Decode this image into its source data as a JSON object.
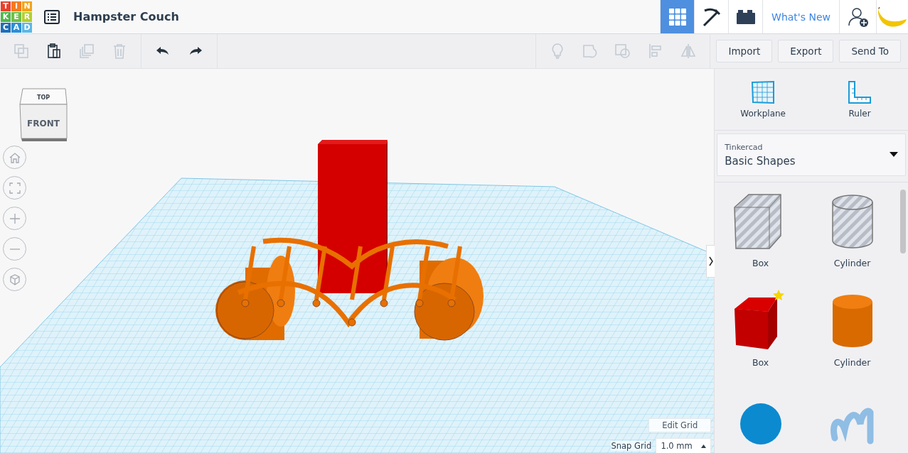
{
  "logo": {
    "letters": [
      {
        "char": "T",
        "color": "#e8412c"
      },
      {
        "char": "I",
        "color": "#f47b20"
      },
      {
        "char": "N",
        "color": "#f2a31b"
      },
      {
        "char": "K",
        "color": "#4fb848"
      },
      {
        "char": "E",
        "color": "#70bf44"
      },
      {
        "char": "R",
        "color": "#b5cf2c"
      },
      {
        "char": "C",
        "color": "#1f6fb8"
      },
      {
        "char": "A",
        "color": "#2b8fd6"
      },
      {
        "char": "D",
        "color": "#5cb8e6"
      }
    ]
  },
  "design_title": "Hampster Couch",
  "nav": [
    {
      "kind": "grid",
      "selected": true
    },
    {
      "kind": "pickaxe",
      "selected": false
    },
    {
      "kind": "bricks",
      "selected": false
    }
  ],
  "whats_new": "What's New",
  "edit_tools": [
    {
      "kind": "copy",
      "disabled": true
    },
    {
      "kind": "paste",
      "disabled": false
    },
    {
      "kind": "duplicate",
      "disabled": true
    },
    {
      "kind": "delete",
      "disabled": true
    }
  ],
  "history_tools": [
    {
      "kind": "undo",
      "disabled": false
    },
    {
      "kind": "redo",
      "disabled": false
    }
  ],
  "shape_tools": [
    {
      "kind": "bulb",
      "disabled": true
    },
    {
      "kind": "note",
      "disabled": true
    },
    {
      "kind": "group",
      "disabled": true
    },
    {
      "kind": "align",
      "disabled": true
    },
    {
      "kind": "mirror",
      "disabled": true
    }
  ],
  "actions": [
    "Import",
    "Export",
    "Send To"
  ],
  "view_cube": {
    "top": "TOP",
    "front": "FRONT"
  },
  "view_controls": [
    {
      "kind": "home"
    },
    {
      "kind": "fit"
    },
    {
      "kind": "zoom-in"
    },
    {
      "kind": "zoom-out"
    },
    {
      "kind": "perspective"
    }
  ],
  "grid": {
    "edit": "Edit Grid",
    "snap_label": "Snap Grid",
    "snap_value": "1.0 mm"
  },
  "panel_tools": [
    {
      "kind": "workplane",
      "label": "Workplane"
    },
    {
      "kind": "ruler",
      "label": "Ruler"
    }
  ],
  "library": {
    "label": "Tinkercad",
    "value": "Basic Shapes"
  },
  "shapes": [
    {
      "kind": "hole-box",
      "label": "Box",
      "starred": false
    },
    {
      "kind": "hole-cylinder",
      "label": "Cylinder",
      "starred": false
    },
    {
      "kind": "box",
      "label": "Box",
      "starred": true
    },
    {
      "kind": "cylinder",
      "label": "Cylinder",
      "starred": false
    },
    {
      "kind": "sphere",
      "starred": false
    },
    {
      "kind": "scribble",
      "starred": false
    }
  ]
}
